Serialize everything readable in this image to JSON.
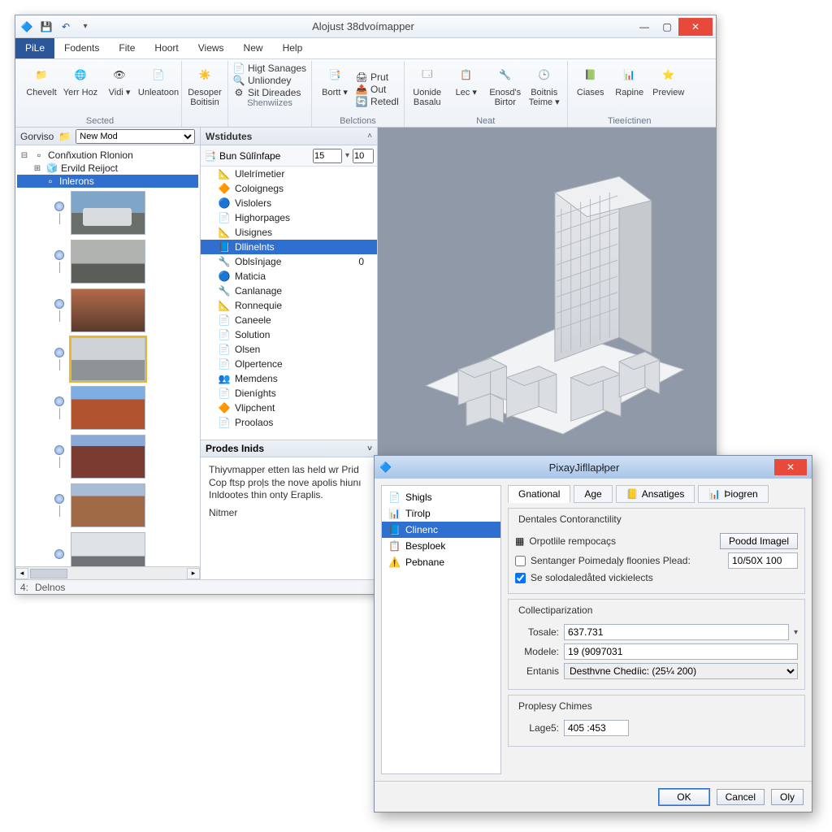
{
  "app": {
    "title": "Alojust 38dvoímapper"
  },
  "menu": [
    "PiLe",
    "Fodents",
    "Fite",
    "Hoort",
    "Views",
    "New",
    "Help"
  ],
  "ribbon": {
    "groups": [
      {
        "caption": "Sected",
        "buttons": [
          {
            "lbl": "Chevelt"
          },
          {
            "lbl": "Yerr Hoz"
          },
          {
            "lbl": "Vidi ▾"
          },
          {
            "lbl": "Unleatoon"
          }
        ]
      },
      {
        "caption": "",
        "buttons": [
          {
            "lbl": "Desoper Boitisin"
          }
        ]
      },
      {
        "caption": "Shenwiizes",
        "small": [
          [
            "Higt Sanages"
          ],
          [
            "Unliondey"
          ],
          [
            "Sit  Direades"
          ]
        ]
      },
      {
        "caption": "Belctions",
        "buttons": [
          {
            "lbl": "Bortt ▾"
          }
        ],
        "small": [
          [
            "Prut"
          ],
          [
            "Out"
          ],
          [
            "Retedl"
          ]
        ]
      },
      {
        "caption": "Neat",
        "buttons": [
          {
            "lbl": "Uonide Basalu"
          },
          {
            "lbl": "Lec ▾"
          },
          {
            "lbl": "Enosd's Birtor"
          },
          {
            "lbl": "Boitnis Teime ▾"
          }
        ]
      },
      {
        "caption": "Tieeíctinen",
        "buttons": [
          {
            "lbl": "Ciases"
          },
          {
            "lbl": "Rapine"
          },
          {
            "lbl": "Preview"
          }
        ]
      }
    ]
  },
  "left": {
    "header_label": "Gorviso",
    "dropdown": "New Mod",
    "tree": [
      {
        "indent": 0,
        "label": "Conñxution Rlonion",
        "exp": "⊟"
      },
      {
        "indent": 1,
        "label": "Ervild Reijoct",
        "exp": "⊞"
      },
      {
        "indent": 2,
        "label": "Inlerons",
        "sel": true
      }
    ]
  },
  "mid": {
    "header": "Wstidutes",
    "tool_label": "Bun Sûlînfape",
    "spin1": "15",
    "spin2": "10",
    "items": [
      "Ulelrímetier",
      "Coloignegs",
      "Vislolers",
      "Highorpages",
      "Uisignes",
      "Dllinelnts",
      "Oblsînjage",
      "Maticia",
      "Canlanage",
      "Ronnequie",
      "Caneele",
      "Solution",
      "Olsen",
      "Olpertence",
      "Memdens",
      "Dieníghts",
      "Vlipchent",
      "Proolaos"
    ],
    "sel_index": 5,
    "prodes_header": "Prodes Inids",
    "prodes_text": "Thiyvmapper etten las held wr Prid Cop ftsp proļs the nove apolis hiunı Inldootes thin onty Eraplis.",
    "prodes_name_label": "Nitmer"
  },
  "status": {
    "left_num": "4:",
    "left_label": "Delnos"
  },
  "dialog": {
    "title": "PixayJifllapłper",
    "nav": [
      "Shigls",
      "Tïrolp",
      "Clinenc",
      "Besploek",
      "Pebnane"
    ],
    "nav_sel": 2,
    "tabs": [
      "Gnational",
      "Age",
      "Ansatiges",
      "Þiogren"
    ],
    "tab_active": 0,
    "group1": {
      "legend": "Dentales Contoranctility",
      "opt1_label": "Orpotlile rempocaçs",
      "btn_label": "Poodd Imagel",
      "chk1_label": "Sentanger Poimedaļy floonies Plead:",
      "chk1_value": "10/50X 100",
      "chk2_label": "Se solodaledåted vickielects"
    },
    "group2": {
      "legend": "Collectiparization",
      "rows": [
        {
          "label": "Tosale:",
          "value": "637.731"
        },
        {
          "label": "Modele:",
          "value": "19 (9097031"
        },
        {
          "label": "Entanis",
          "value": "Desthvne Chedíic: (25¼ 200)"
        }
      ]
    },
    "group3": {
      "legend": "Proplesy Chimes",
      "label": "Lage5:",
      "value": "405 :453"
    },
    "footer": {
      "ok": "OK",
      "cancel": "Cancel",
      "oly": "Oly"
    }
  }
}
